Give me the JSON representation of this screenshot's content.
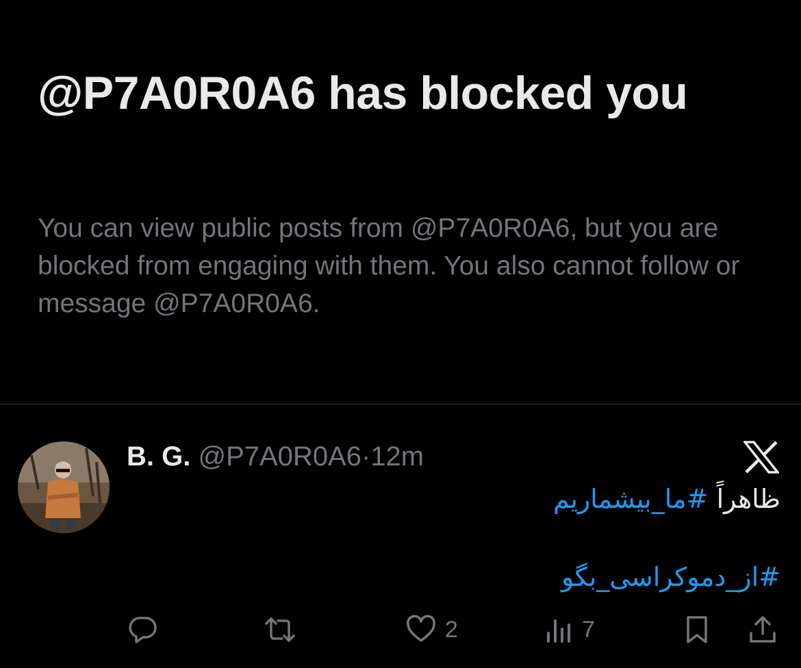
{
  "blocked": {
    "title": "@P7A0R0A6 has blocked you",
    "description": "You can view public posts from @P7A0R0A6, but you are blocked from engaging with them. You also cannot follow or message @P7A0R0A6."
  },
  "tweet": {
    "author_name": "B. G.",
    "handle": "@P7A0R0A6",
    "separator": "·",
    "time": "12m",
    "line1_plain": "ظاهراً",
    "line1_hashtag": "#ما_بیشماریم",
    "line2_hashtag": "#از_دموکراسی_بگو"
  },
  "actions": {
    "reply_count": "",
    "repost_count": "",
    "like_count": "2",
    "views_count": "7"
  },
  "colors": {
    "background": "#000000",
    "primary_text": "#e7e9ea",
    "secondary_text": "#71767b",
    "link": "#1d9bf0",
    "divider": "#2f3336"
  },
  "icons": [
    "x-logo-icon",
    "reply-icon",
    "repost-icon",
    "like-icon",
    "views-icon",
    "bookmark-icon",
    "share-icon"
  ]
}
